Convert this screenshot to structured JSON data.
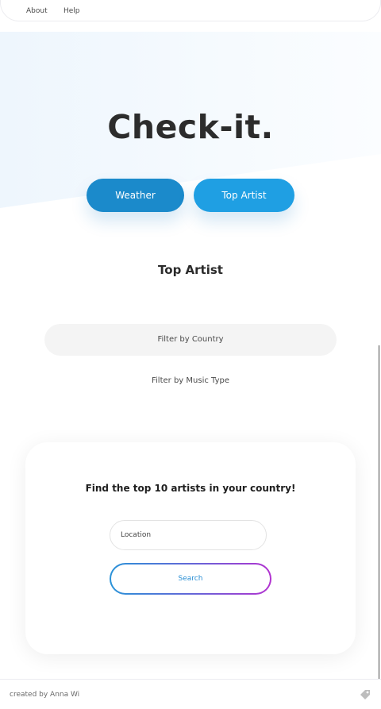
{
  "nav": {
    "about": "About",
    "help": "Help"
  },
  "hero": {
    "title": "Check-it."
  },
  "buttons": {
    "weather": "Weather",
    "top_artist": "Top Artist"
  },
  "section": {
    "title": "Top Artist"
  },
  "filters": {
    "country": "Filter by Country",
    "music_type": "Filter by Music Type"
  },
  "card": {
    "heading": "Find the top 10 artists in your country!",
    "location_placeholder": "Location",
    "search_label": "Search"
  },
  "footer": {
    "credit": "created by Anna Wi",
    "icon": "tag-icon"
  },
  "colors": {
    "weather_button": "#1b8acb",
    "top_artist_button": "#1f9fe3",
    "search_gradient_start": "#2a93d8",
    "search_gradient_end": "#b232d0"
  }
}
